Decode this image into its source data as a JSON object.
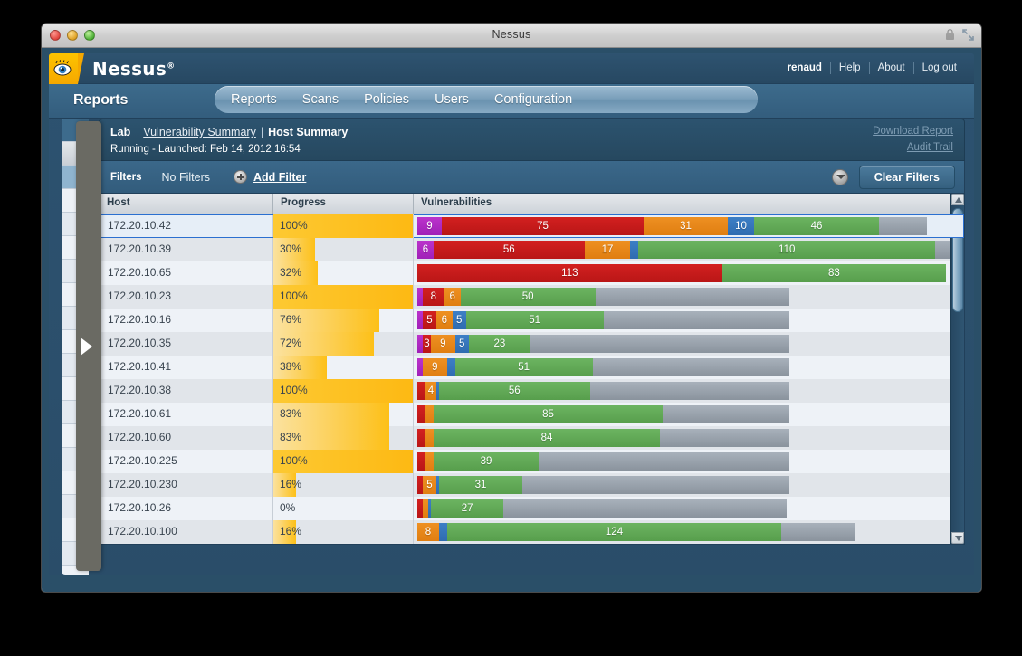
{
  "window": {
    "title": "Nessus",
    "traffic_lights": [
      "close-button",
      "minimize-button",
      "zoom-button"
    ]
  },
  "brand": {
    "name": "Nessus",
    "trademark": "®",
    "logo_icon": "nessus-eye-icon"
  },
  "topnav": {
    "user": "renaud",
    "items": [
      "Help",
      "About",
      "Log out"
    ]
  },
  "section": {
    "title": "Reports"
  },
  "tabs": [
    {
      "label": "Reports",
      "active": true
    },
    {
      "label": "Scans",
      "active": false
    },
    {
      "label": "Policies",
      "active": false
    },
    {
      "label": "Users",
      "active": false
    },
    {
      "label": "Configuration",
      "active": false
    }
  ],
  "report_header": {
    "scan_name": "Lab",
    "breadcrumb_link": "Vulnerability Summary",
    "separator": "|",
    "breadcrumb_current": "Host Summary",
    "status_line": "Running - Launched: Feb 14, 2012 16:54",
    "download_report": "Download Report",
    "audit_trail": "Audit Trail"
  },
  "filters": {
    "label": "Filters",
    "state": "No Filters",
    "add_filter": "Add Filter",
    "add_filter_icon": "plus-circle-icon",
    "options_icon": "chevron-down-circle-icon",
    "clear_button": "Clear Filters"
  },
  "table": {
    "columns": [
      "Host",
      "Progress",
      "Vulnerabilities"
    ],
    "sort_icon": "caret-down-icon",
    "rows": [
      {
        "host": "172.20.10.42",
        "progress": "100%",
        "progress_pct": 100,
        "selected": true,
        "segments": [
          {
            "sev": "crit",
            "label": "9",
            "value": 9
          },
          {
            "sev": "high",
            "label": "75",
            "value": 75
          },
          {
            "sev": "med",
            "label": "31",
            "value": 31
          },
          {
            "sev": "low",
            "label": "10",
            "value": 10
          },
          {
            "sev": "info",
            "label": "46",
            "value": 46
          },
          {
            "sev": "open",
            "label": "",
            "value": 18
          }
        ]
      },
      {
        "host": "172.20.10.39",
        "progress": "30%",
        "progress_pct": 30,
        "selected": false,
        "segments": [
          {
            "sev": "crit",
            "label": "6",
            "value": 6
          },
          {
            "sev": "high",
            "label": "56",
            "value": 56
          },
          {
            "sev": "med",
            "label": "17",
            "value": 17
          },
          {
            "sev": "low",
            "label": "",
            "value": 3
          },
          {
            "sev": "info",
            "label": "110",
            "value": 110
          },
          {
            "sev": "open",
            "label": "",
            "value": 6
          }
        ]
      },
      {
        "host": "172.20.10.65",
        "progress": "32%",
        "progress_pct": 32,
        "selected": false,
        "segments": [
          {
            "sev": "high",
            "label": "113",
            "value": 113
          },
          {
            "sev": "info",
            "label": "83",
            "value": 83
          }
        ]
      },
      {
        "host": "172.20.10.23",
        "progress": "100%",
        "progress_pct": 100,
        "selected": false,
        "segments": [
          {
            "sev": "crit",
            "label": "",
            "value": 2
          },
          {
            "sev": "high",
            "label": "8",
            "value": 8
          },
          {
            "sev": "med",
            "label": "6",
            "value": 6
          },
          {
            "sev": "info",
            "label": "50",
            "value": 50
          },
          {
            "sev": "open",
            "label": "",
            "value": 72
          }
        ]
      },
      {
        "host": "172.20.10.16",
        "progress": "76%",
        "progress_pct": 76,
        "selected": false,
        "segments": [
          {
            "sev": "crit",
            "label": "",
            "value": 2
          },
          {
            "sev": "high",
            "label": "5",
            "value": 5
          },
          {
            "sev": "med",
            "label": "6",
            "value": 6
          },
          {
            "sev": "low",
            "label": "5",
            "value": 5
          },
          {
            "sev": "info",
            "label": "51",
            "value": 51
          },
          {
            "sev": "open",
            "label": "",
            "value": 69
          }
        ]
      },
      {
        "host": "172.20.10.35",
        "progress": "72%",
        "progress_pct": 72,
        "selected": false,
        "segments": [
          {
            "sev": "crit",
            "label": "",
            "value": 2
          },
          {
            "sev": "high",
            "label": "3",
            "value": 3
          },
          {
            "sev": "med",
            "label": "9",
            "value": 9
          },
          {
            "sev": "low",
            "label": "5",
            "value": 5
          },
          {
            "sev": "info",
            "label": "23",
            "value": 23
          },
          {
            "sev": "open",
            "label": "",
            "value": 96
          }
        ]
      },
      {
        "host": "172.20.10.41",
        "progress": "38%",
        "progress_pct": 38,
        "selected": false,
        "segments": [
          {
            "sev": "crit",
            "label": "",
            "value": 2
          },
          {
            "sev": "med",
            "label": "9",
            "value": 9
          },
          {
            "sev": "low",
            "label": "",
            "value": 3
          },
          {
            "sev": "info",
            "label": "51",
            "value": 51
          },
          {
            "sev": "open",
            "label": "",
            "value": 73
          }
        ]
      },
      {
        "host": "172.20.10.38",
        "progress": "100%",
        "progress_pct": 100,
        "selected": false,
        "segments": [
          {
            "sev": "high",
            "label": "",
            "value": 3
          },
          {
            "sev": "med",
            "label": "4",
            "value": 4
          },
          {
            "sev": "low",
            "label": "",
            "value": 1
          },
          {
            "sev": "info",
            "label": "56",
            "value": 56
          },
          {
            "sev": "open",
            "label": "",
            "value": 74
          }
        ]
      },
      {
        "host": "172.20.10.61",
        "progress": "83%",
        "progress_pct": 83,
        "selected": false,
        "segments": [
          {
            "sev": "high",
            "label": "",
            "value": 3
          },
          {
            "sev": "med",
            "label": "",
            "value": 3
          },
          {
            "sev": "info",
            "label": "85",
            "value": 85
          },
          {
            "sev": "open",
            "label": "",
            "value": 47
          }
        ]
      },
      {
        "host": "172.20.10.60",
        "progress": "83%",
        "progress_pct": 83,
        "selected": false,
        "segments": [
          {
            "sev": "high",
            "label": "",
            "value": 3
          },
          {
            "sev": "med",
            "label": "",
            "value": 3
          },
          {
            "sev": "info",
            "label": "84",
            "value": 84
          },
          {
            "sev": "open",
            "label": "",
            "value": 48
          }
        ]
      },
      {
        "host": "172.20.10.225",
        "progress": "100%",
        "progress_pct": 100,
        "selected": false,
        "segments": [
          {
            "sev": "high",
            "label": "",
            "value": 3
          },
          {
            "sev": "med",
            "label": "",
            "value": 3
          },
          {
            "sev": "info",
            "label": "39",
            "value": 39
          },
          {
            "sev": "open",
            "label": "",
            "value": 93
          }
        ]
      },
      {
        "host": "172.20.10.230",
        "progress": "16%",
        "progress_pct": 16,
        "selected": false,
        "segments": [
          {
            "sev": "high",
            "label": "",
            "value": 2
          },
          {
            "sev": "med",
            "label": "5",
            "value": 5
          },
          {
            "sev": "low",
            "label": "",
            "value": 1
          },
          {
            "sev": "info",
            "label": "31",
            "value": 31
          },
          {
            "sev": "open",
            "label": "",
            "value": 99
          }
        ]
      },
      {
        "host": "172.20.10.26",
        "progress": "0%",
        "progress_pct": 0,
        "selected": false,
        "segments": [
          {
            "sev": "high",
            "label": "",
            "value": 2
          },
          {
            "sev": "med",
            "label": "",
            "value": 2
          },
          {
            "sev": "low",
            "label": "",
            "value": 1
          },
          {
            "sev": "info",
            "label": "27",
            "value": 27
          },
          {
            "sev": "open",
            "label": "",
            "value": 105
          }
        ]
      },
      {
        "host": "172.20.10.100",
        "progress": "16%",
        "progress_pct": 16,
        "selected": false,
        "segments": [
          {
            "sev": "med",
            "label": "8",
            "value": 8
          },
          {
            "sev": "low",
            "label": "",
            "value": 3
          },
          {
            "sev": "info",
            "label": "124",
            "value": 124
          },
          {
            "sev": "open",
            "label": "",
            "value": 27
          }
        ]
      }
    ]
  },
  "scrollbar": {
    "up_icon": "scroll-up-arrow-icon",
    "down_icon": "scroll-down-arrow-icon"
  },
  "colors": {
    "critical": "#a020b8",
    "high": "#b91616",
    "medium": "#e07e11",
    "low": "#2f6cb0",
    "info": "#579e4c",
    "open_port": "#8a939d",
    "brand_yellow": "#f5a800",
    "app_blue": "#2a4f68"
  }
}
